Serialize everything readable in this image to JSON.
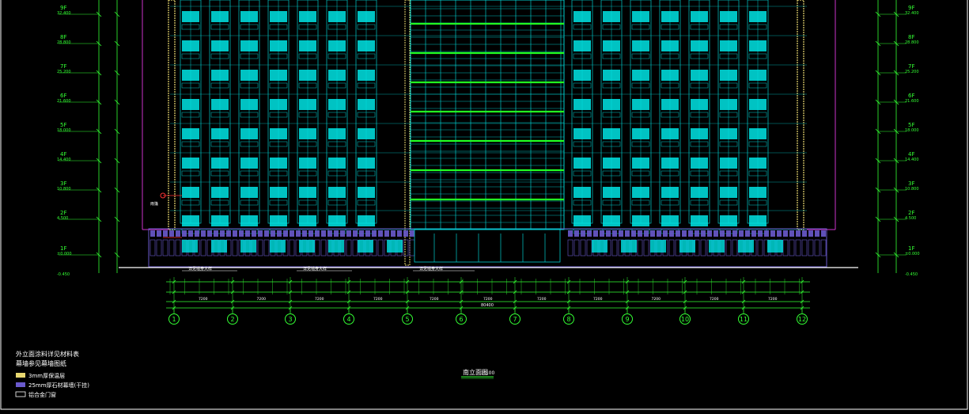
{
  "drawing": {
    "title": "南立面图",
    "title_scale": "1:100",
    "frame_color": "#ffffff",
    "colors": {
      "glass": "#00e5e5",
      "frame": "#00cccc",
      "floor_bands": "#22ff22",
      "cladding": "#6a5acd",
      "axis": "#33ff33",
      "dims": "#33ff33",
      "levels": "#33ff33",
      "magenta": "#cc33cc",
      "text": "#ffffff",
      "insulation": "#e8d870",
      "marker": "#ff3333"
    }
  },
  "floors_left": [
    {
      "name": "9F",
      "elev": "32.400"
    },
    {
      "name": "8F",
      "elev": "28.800"
    },
    {
      "name": "7F",
      "elev": "25.200"
    },
    {
      "name": "6F",
      "elev": "21.600"
    },
    {
      "name": "5F",
      "elev": "18.000"
    },
    {
      "name": "4F",
      "elev": "14.400"
    },
    {
      "name": "3F",
      "elev": "10.800"
    },
    {
      "name": "2F",
      "elev": "4.500"
    },
    {
      "name": "1F",
      "elev": "±0.000"
    }
  ],
  "floors_right": [
    {
      "name": "9F",
      "elev": "32.400"
    },
    {
      "name": "8F",
      "elev": "28.800"
    },
    {
      "name": "7F",
      "elev": "25.200"
    },
    {
      "name": "6F",
      "elev": "21.600"
    },
    {
      "name": "5F",
      "elev": "18.000"
    },
    {
      "name": "4F",
      "elev": "14.400"
    },
    {
      "name": "3F",
      "elev": "10.800"
    },
    {
      "name": "2F",
      "elev": "4.500"
    },
    {
      "name": "1F",
      "elev": "±0.000"
    }
  ],
  "ground_left": "-0.450",
  "ground_right": "-0.450",
  "axes": [
    "1",
    "2",
    "3",
    "4",
    "5",
    "6",
    "7",
    "8",
    "9",
    "10",
    "11",
    "12"
  ],
  "dimension_total": "80400",
  "dimension_row2": [
    "7200",
    "7200",
    "7200",
    "7200",
    "7200",
    "7200",
    "7200",
    "7200",
    "7200",
    "7200",
    "7200"
  ],
  "notes": {
    "line1": "外立面涂料详见材料表",
    "line2": "幕墙参见幕墙图纸"
  },
  "legend": [
    {
      "swatch": "insulation",
      "label": "3mm厚保温层"
    },
    {
      "swatch": "cladding",
      "label": "25mm厚石材幕墙(干挂)"
    },
    {
      "swatch": "outline",
      "label": "铝合金门窗"
    }
  ],
  "annotations": {
    "canopy_left": "雨篷",
    "section_a": "详见墙身大样",
    "section_b": "详见墙身大样",
    "section_c": "详见墙身大样"
  }
}
